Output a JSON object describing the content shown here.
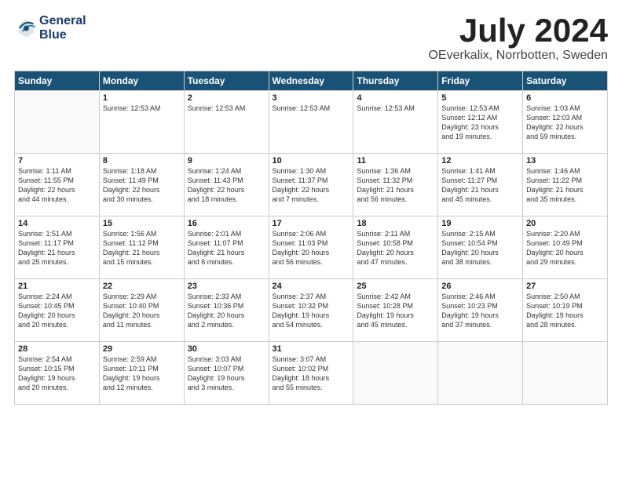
{
  "logo": {
    "line1": "General",
    "line2": "Blue"
  },
  "title": "July 2024",
  "location": "OEverkalix, Norrbotten, Sweden",
  "headers": [
    "Sunday",
    "Monday",
    "Tuesday",
    "Wednesday",
    "Thursday",
    "Friday",
    "Saturday"
  ],
  "weeks": [
    [
      {
        "day": "",
        "info": ""
      },
      {
        "day": "1",
        "info": "Sunrise: 12:53 AM"
      },
      {
        "day": "2",
        "info": "Sunrise: 12:53 AM"
      },
      {
        "day": "3",
        "info": "Sunrise: 12:53 AM"
      },
      {
        "day": "4",
        "info": "Sunrise: 12:53 AM"
      },
      {
        "day": "5",
        "info": "Sunrise: 12:53 AM\nSunset: 12:12 AM\nDaylight: 23 hours\nand 19 minutes."
      },
      {
        "day": "6",
        "info": "Sunrise: 1:03 AM\nSunset: 12:03 AM\nDaylight: 22 hours\nand 59 minutes."
      }
    ],
    [
      {
        "day": "7",
        "info": "Sunrise: 1:11 AM\nSunset: 11:55 PM\nDaylight: 22 hours\nand 44 minutes."
      },
      {
        "day": "8",
        "info": "Sunrise: 1:18 AM\nSunset: 11:49 PM\nDaylight: 22 hours\nand 30 minutes."
      },
      {
        "day": "9",
        "info": "Sunrise: 1:24 AM\nSunset: 11:43 PM\nDaylight: 22 hours\nand 18 minutes."
      },
      {
        "day": "10",
        "info": "Sunrise: 1:30 AM\nSunset: 11:37 PM\nDaylight: 22 hours\nand 7 minutes."
      },
      {
        "day": "11",
        "info": "Sunrise: 1:36 AM\nSunset: 11:32 PM\nDaylight: 21 hours\nand 56 minutes."
      },
      {
        "day": "12",
        "info": "Sunrise: 1:41 AM\nSunset: 11:27 PM\nDaylight: 21 hours\nand 45 minutes."
      },
      {
        "day": "13",
        "info": "Sunrise: 1:46 AM\nSunset: 11:22 PM\nDaylight: 21 hours\nand 35 minutes."
      }
    ],
    [
      {
        "day": "14",
        "info": "Sunrise: 1:51 AM\nSunset: 11:17 PM\nDaylight: 21 hours\nand 25 minutes."
      },
      {
        "day": "15",
        "info": "Sunrise: 1:56 AM\nSunset: 11:12 PM\nDaylight: 21 hours\nand 15 minutes."
      },
      {
        "day": "16",
        "info": "Sunrise: 2:01 AM\nSunset: 11:07 PM\nDaylight: 21 hours\nand 6 minutes."
      },
      {
        "day": "17",
        "info": "Sunrise: 2:06 AM\nSunset: 11:03 PM\nDaylight: 20 hours\nand 56 minutes."
      },
      {
        "day": "18",
        "info": "Sunrise: 2:11 AM\nSunset: 10:58 PM\nDaylight: 20 hours\nand 47 minutes."
      },
      {
        "day": "19",
        "info": "Sunrise: 2:15 AM\nSunset: 10:54 PM\nDaylight: 20 hours\nand 38 minutes."
      },
      {
        "day": "20",
        "info": "Sunrise: 2:20 AM\nSunset: 10:49 PM\nDaylight: 20 hours\nand 29 minutes."
      }
    ],
    [
      {
        "day": "21",
        "info": "Sunrise: 2:24 AM\nSunset: 10:45 PM\nDaylight: 20 hours\nand 20 minutes."
      },
      {
        "day": "22",
        "info": "Sunrise: 2:29 AM\nSunset: 10:40 PM\nDaylight: 20 hours\nand 11 minutes."
      },
      {
        "day": "23",
        "info": "Sunrise: 2:33 AM\nSunset: 10:36 PM\nDaylight: 20 hours\nand 2 minutes."
      },
      {
        "day": "24",
        "info": "Sunrise: 2:37 AM\nSunset: 10:32 PM\nDaylight: 19 hours\nand 54 minutes."
      },
      {
        "day": "25",
        "info": "Sunrise: 2:42 AM\nSunset: 10:28 PM\nDaylight: 19 hours\nand 45 minutes."
      },
      {
        "day": "26",
        "info": "Sunrise: 2:46 AM\nSunset: 10:23 PM\nDaylight: 19 hours\nand 37 minutes."
      },
      {
        "day": "27",
        "info": "Sunrise: 2:50 AM\nSunset: 10:19 PM\nDaylight: 19 hours\nand 28 minutes."
      }
    ],
    [
      {
        "day": "28",
        "info": "Sunrise: 2:54 AM\nSunset: 10:15 PM\nDaylight: 19 hours\nand 20 minutes."
      },
      {
        "day": "29",
        "info": "Sunrise: 2:59 AM\nSunset: 10:11 PM\nDaylight: 19 hours\nand 12 minutes."
      },
      {
        "day": "30",
        "info": "Sunrise: 3:03 AM\nSunset: 10:07 PM\nDaylight: 19 hours\nand 3 minutes."
      },
      {
        "day": "31",
        "info": "Sunrise: 3:07 AM\nSunset: 10:02 PM\nDaylight: 18 hours\nand 55 minutes."
      },
      {
        "day": "",
        "info": ""
      },
      {
        "day": "",
        "info": ""
      },
      {
        "day": "",
        "info": ""
      }
    ]
  ]
}
